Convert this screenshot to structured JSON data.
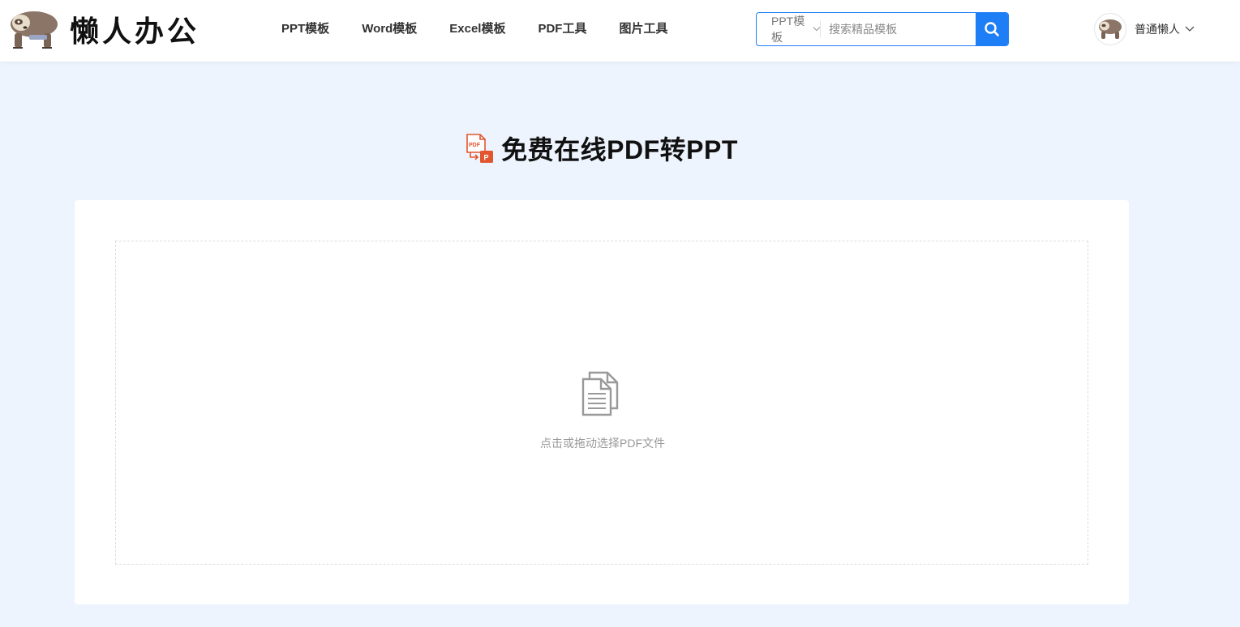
{
  "brand": {
    "name": "懒人办公",
    "mascot_icon": "sloth-mascot-icon"
  },
  "nav": {
    "items": [
      {
        "label": "PPT模板"
      },
      {
        "label": "Word模板"
      },
      {
        "label": "Excel模板"
      },
      {
        "label": "PDF工具"
      },
      {
        "label": "图片工具"
      }
    ]
  },
  "search": {
    "type_selected": "PPT模板",
    "placeholder": "搜索精品模板",
    "value": "",
    "button_icon": "search-icon"
  },
  "user": {
    "name": "普通懒人",
    "avatar_icon": "sloth-avatar-icon"
  },
  "page": {
    "title": "免费在线PDF转PPT",
    "title_icon": "pdf-to-ppt-icon"
  },
  "upload": {
    "hint": "点击或拖动选择PDF文件",
    "icon": "document-files-icon"
  },
  "colors": {
    "accent": "#1e7ef5",
    "page_background": "#eef4fd",
    "pdf_red": "#e2562f",
    "mascot_brown": "#8a7566"
  }
}
